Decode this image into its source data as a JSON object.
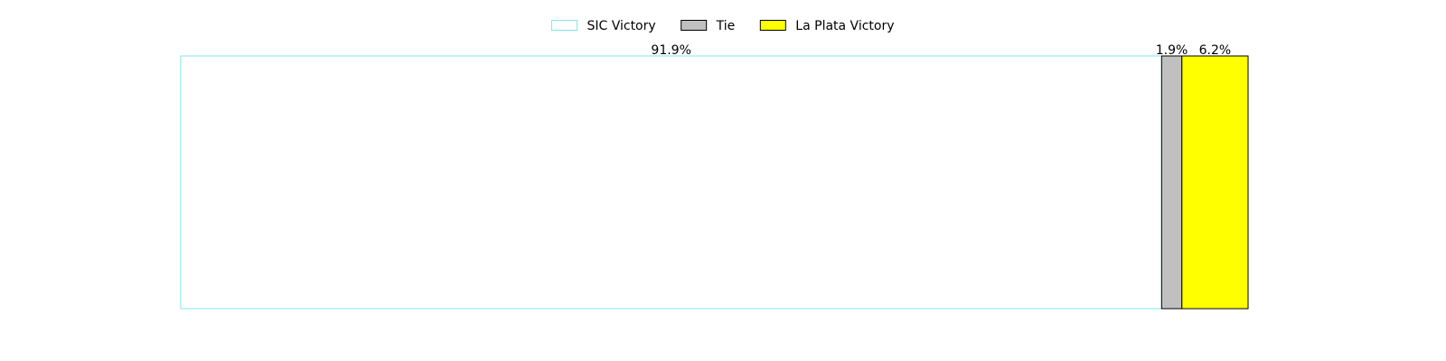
{
  "chart_data": {
    "type": "bar",
    "orientation": "horizontal-stacked",
    "title": "",
    "xlabel": "",
    "ylabel": "",
    "axes_visible": false,
    "grid": false,
    "legend_position": "top-center",
    "series": [
      {
        "name": "SIC Victory",
        "value": 91.9,
        "label": "91.9%",
        "fill": "#ffffff",
        "stroke": "#7fe6f0"
      },
      {
        "name": "Tie",
        "value": 1.9,
        "label": "1.9%",
        "fill": "#c0c0c0",
        "stroke": "#000000"
      },
      {
        "name": "La Plata Victory",
        "value": 6.2,
        "label": "6.2%",
        "fill": "#ffff00",
        "stroke": "#000000"
      }
    ]
  }
}
